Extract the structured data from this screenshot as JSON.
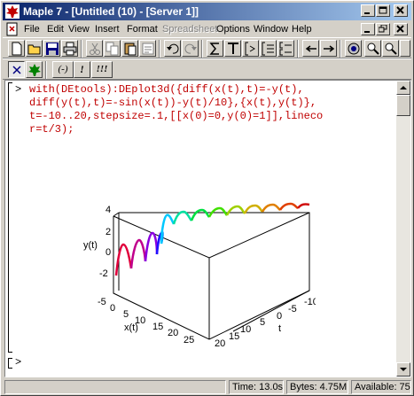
{
  "window": {
    "title": "Maple 7 - [Untitled (10) - [Server 1]]"
  },
  "menubar": {
    "items": [
      "File",
      "Edit",
      "View",
      "Insert",
      "Format",
      "Spreadsheet",
      "Options",
      "Window",
      "Help"
    ],
    "disabled": [
      "Spreadsheet"
    ]
  },
  "toolbar2": {
    "items": [
      "(-)",
      "!",
      "!!!"
    ]
  },
  "worksheet": {
    "prompt": ">",
    "code_lines": [
      "with(DEtools):DEplot3d({diff(x(t),t)=-y(t),",
      "diff(y(t),t)=-sin(x(t))-y(t)/10},{x(t),y(t)},",
      "t=-10..20,stepsize=.1,[[x(0)=0,y(0)=1]],lineco",
      "r=t/3);"
    ],
    "empty_prompt": ">"
  },
  "plot": {
    "axis_labels": {
      "y": "y(t)",
      "x": "x(t)",
      "t": "t"
    },
    "y_ticks": [
      "4",
      "2",
      "0",
      "-2"
    ],
    "x_ticks": [
      "-5",
      "0",
      "5",
      "10",
      "15",
      "20",
      "25"
    ],
    "t_ticks": [
      "-10",
      "-5",
      "0",
      "5",
      "10",
      "15",
      "20"
    ]
  },
  "statusbar": {
    "time": "Time: 13.0s",
    "bytes": "Bytes: 4.75M",
    "available": "Available: 75.1M"
  },
  "colors": {
    "titlebar_start": "#0a246a",
    "input_text": "#c00000"
  }
}
